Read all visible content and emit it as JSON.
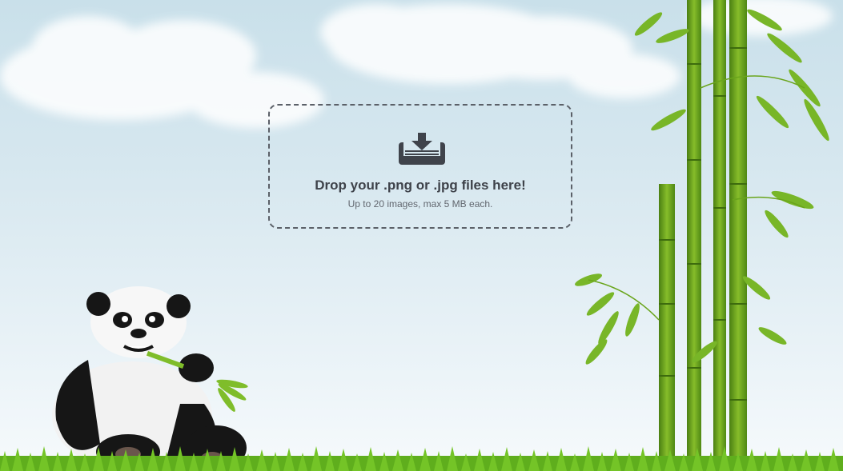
{
  "dropzone": {
    "icon": "download-tray-icon",
    "title": "Drop your .png or .jpg files here!",
    "subtitle": "Up to 20 images, max 5 MB each."
  },
  "illustration": {
    "panda": "panda-mascot",
    "bamboo": "bamboo-stalks",
    "grass": "grass-strip",
    "clouds": "cloud-background"
  },
  "colors": {
    "sky_top": "#c9e0ea",
    "sky_bottom": "#f6fafc",
    "dropzone_border": "#5b6068",
    "title_text": "#3e424a",
    "subtitle_text": "#62676f",
    "bamboo_green": "#6aa51c",
    "grass_green": "#5fae1d"
  }
}
